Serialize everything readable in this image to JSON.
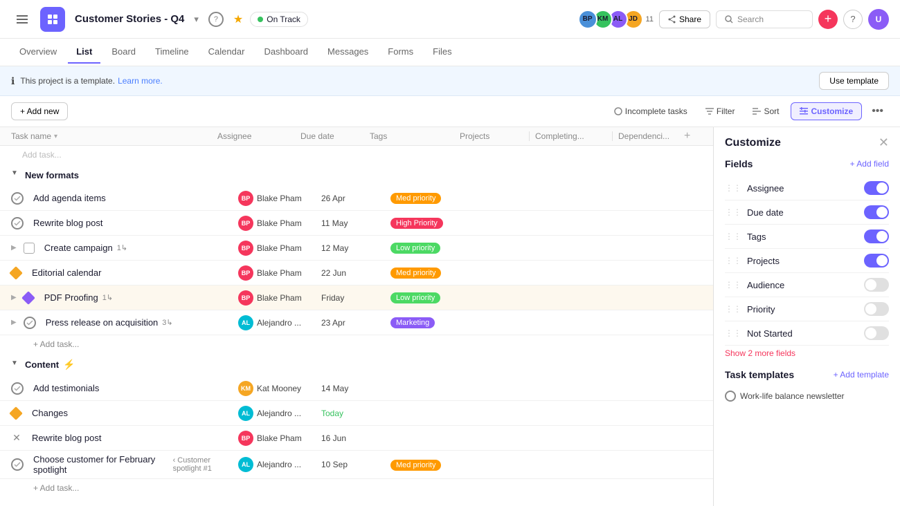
{
  "topbar": {
    "project_title": "Customer Stories - Q4",
    "status": "On Track",
    "avatar_count": "11",
    "share_label": "Share",
    "search_placeholder": "Search",
    "help_label": "?"
  },
  "tabs": [
    {
      "label": "Overview",
      "active": false
    },
    {
      "label": "List",
      "active": true
    },
    {
      "label": "Board",
      "active": false
    },
    {
      "label": "Timeline",
      "active": false
    },
    {
      "label": "Calendar",
      "active": false
    },
    {
      "label": "Dashboard",
      "active": false
    },
    {
      "label": "Messages",
      "active": false
    },
    {
      "label": "Forms",
      "active": false
    },
    {
      "label": "Files",
      "active": false
    }
  ],
  "banner": {
    "text": "This project is a template.",
    "learn_more": "Learn more.",
    "use_template": "Use template"
  },
  "toolbar": {
    "add_new": "+ Add new",
    "incomplete_tasks": "Incomplete tasks",
    "filter": "Filter",
    "sort": "Sort",
    "customize": "Customize",
    "more": "..."
  },
  "columns": {
    "task_name": "Task name",
    "assignee": "Assignee",
    "due_date": "Due date",
    "tags": "Tags",
    "projects": "Projects",
    "completing": "Completing...",
    "dependencies": "Dependenci..."
  },
  "sections": [
    {
      "name": "New formats",
      "tasks": [
        {
          "name": "Add agenda items",
          "check": "circle",
          "assignee": "Blake Pham",
          "av_color": "av-red",
          "due_date": "26 Apr",
          "tag": "Med priority",
          "tag_class": "tag-med"
        },
        {
          "name": "Rewrite blog post",
          "check": "circle",
          "assignee": "Blake Pham",
          "av_color": "av-red",
          "due_date": "11 May",
          "tag": "High Priority",
          "tag_class": "tag-high"
        },
        {
          "name": "Create campaign",
          "check": "task",
          "assignee": "Blake Pham",
          "av_color": "av-red",
          "due_date": "12 May",
          "tag": "Low priority",
          "tag_class": "tag-low",
          "subtask": "1",
          "expandable": true
        },
        {
          "name": "Editorial calendar",
          "check": "diamond",
          "assignee": "Blake Pham",
          "av_color": "av-red",
          "due_date": "22 Jun",
          "tag": "Med priority",
          "tag_class": "tag-med"
        },
        {
          "name": "PDF Proofing",
          "check": "diamond-purple",
          "assignee": "Blake Pham",
          "av_color": "av-red",
          "due_date": "Friday",
          "tag": "Low priority",
          "tag_class": "tag-low",
          "subtask": "1",
          "expandable": true,
          "highlighted": true
        },
        {
          "name": "Press release on acquisition",
          "check": "circle",
          "assignee": "Alejandro ...",
          "av_color": "av-teal",
          "due_date": "23 Apr",
          "tag": "Marketing",
          "tag_class": "tag-marketing",
          "subtask": "3",
          "expandable": true
        }
      ]
    },
    {
      "name": "Content",
      "icon": "⚡",
      "tasks": [
        {
          "name": "Add testimonials",
          "check": "circle",
          "assignee": "Kat Mooney",
          "av_color": "av-orange",
          "due_date": "14 May",
          "tag": "",
          "tag_class": ""
        },
        {
          "name": "Changes",
          "check": "diamond",
          "assignee": "Alejandro ...",
          "av_color": "av-teal",
          "due_date": "Today",
          "date_class": "today",
          "tag": "",
          "tag_class": ""
        },
        {
          "name": "Rewrite blog post",
          "check": "cross",
          "assignee": "Blake Pham",
          "av_color": "av-red",
          "due_date": "16 Jun",
          "tag": "",
          "tag_class": ""
        },
        {
          "name": "Choose customer for February spotlight",
          "check": "circle",
          "assignee": "Alejandro ...",
          "av_color": "av-teal",
          "due_date": "10 Sep",
          "tag": "Med priority",
          "tag_class": "tag-med",
          "sub_project": "Customer spotlight #1"
        }
      ]
    }
  ],
  "customize_panel": {
    "title": "Customize",
    "close": "×",
    "fields_title": "Fields",
    "add_field": "+ Add field",
    "fields": [
      {
        "name": "Assignee",
        "enabled": true
      },
      {
        "name": "Due date",
        "enabled": true
      },
      {
        "name": "Tags",
        "enabled": true
      },
      {
        "name": "Projects",
        "enabled": true
      },
      {
        "name": "Audience",
        "enabled": false
      },
      {
        "name": "Priority",
        "enabled": false
      },
      {
        "name": "Not Started",
        "enabled": false
      }
    ],
    "show_more": "Show 2 more fields",
    "task_templates_title": "Task templates",
    "add_template": "+ Add template",
    "templates": [
      {
        "name": "Work-life balance newsletter"
      }
    ]
  }
}
